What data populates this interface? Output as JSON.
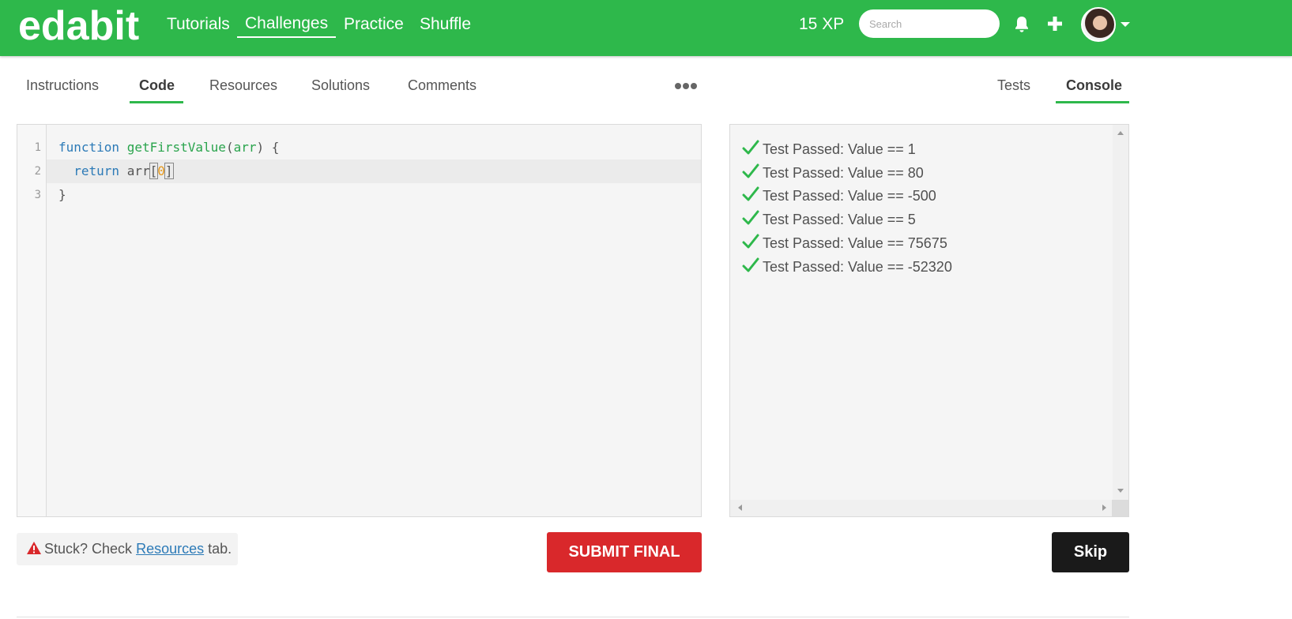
{
  "header": {
    "logo": "edabit",
    "nav": [
      "Tutorials",
      "Challenges",
      "Practice",
      "Shuffle"
    ],
    "active_nav": "Challenges",
    "xp": "15 XP",
    "search_placeholder": "Search",
    "brand_color": "#2eb84b"
  },
  "tabs": {
    "left": [
      "Instructions",
      "Code",
      "Resources",
      "Solutions",
      "Comments"
    ],
    "active_left": "Code",
    "right": [
      "Tests",
      "Console"
    ],
    "active_right": "Console"
  },
  "editor": {
    "line_numbers": [
      "1",
      "2",
      "3"
    ],
    "lines": [
      {
        "kw": "function",
        "fn": "getFirstValue",
        "open": "(",
        "param": "arr",
        "close": ") {"
      },
      {
        "kw": "return",
        "ident": "arr",
        "lb": "[",
        "num": "0",
        "rb": "]"
      },
      {
        "text": "}"
      }
    ]
  },
  "console": {
    "results": [
      "Test Passed: Value == 1",
      "Test Passed: Value == 80",
      "Test Passed: Value == -500",
      "Test Passed: Value == 5",
      "Test Passed: Value == 75675",
      "Test Passed: Value == -52320"
    ]
  },
  "footer": {
    "stuck_prefix": "Stuck? Check",
    "stuck_link": "Resources",
    "stuck_suffix": "tab.",
    "submit_label": "SUBMIT FINAL",
    "skip_label": "Skip",
    "submit_color": "#d9282b"
  }
}
